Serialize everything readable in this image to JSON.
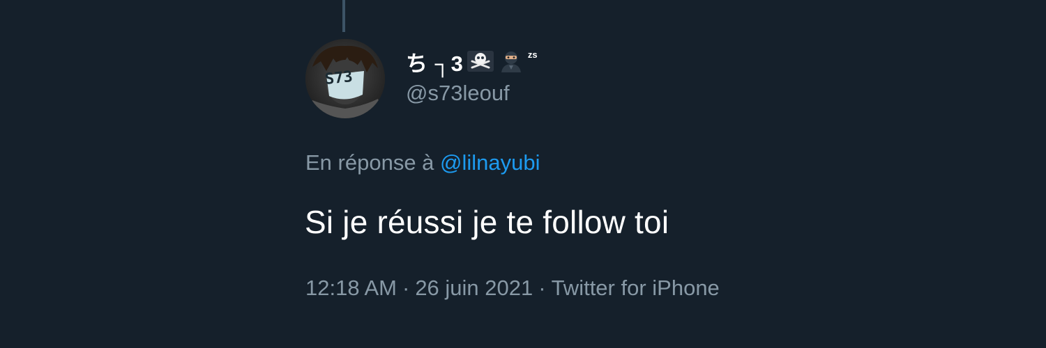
{
  "tweet": {
    "author": {
      "display_name": "ち ┐3",
      "name_badge": "zs",
      "handle": "@s73leouf",
      "avatar_text": "S73",
      "emoji_icons": [
        "skull-crossbones-icon",
        "ninja-icon"
      ]
    },
    "reply": {
      "prefix": "En réponse à",
      "mention": "@lilnayubi"
    },
    "text": "Si je réussi je te follow toi",
    "meta": {
      "time": "12:18 AM",
      "separator": "·",
      "date": "26 juin 2021",
      "source": "Twitter for iPhone"
    }
  },
  "colors": {
    "background": "#15202b",
    "primary_text": "#ffffff",
    "secondary_text": "#8899a6",
    "link": "#1d9bf0",
    "thread_line": "#3d5466"
  }
}
